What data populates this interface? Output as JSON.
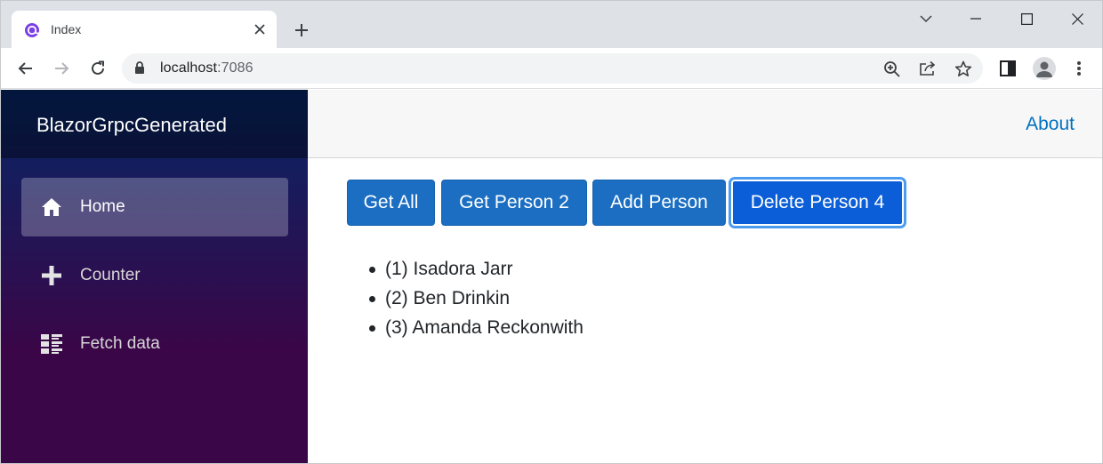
{
  "browser": {
    "tab_title": "Index",
    "url_host": "localhost",
    "url_port": ":7086"
  },
  "app": {
    "brand": "BlazorGrpcGenerated",
    "about_link": "About",
    "nav": [
      {
        "label": "Home",
        "icon": "home-icon",
        "active": true
      },
      {
        "label": "Counter",
        "icon": "plus-icon",
        "active": false
      },
      {
        "label": "Fetch data",
        "icon": "list-icon",
        "active": false
      }
    ],
    "buttons": [
      {
        "label": "Get All"
      },
      {
        "label": "Get Person 2"
      },
      {
        "label": "Add Person"
      },
      {
        "label": "Delete Person 4",
        "focused": true
      }
    ],
    "people": [
      "(1) Isadora Jarr",
      "(2) Ben Drinkin",
      "(3) Amanda Reckonwith"
    ]
  },
  "colors": {
    "accent": "#1b6ec2",
    "link": "#0071c1",
    "sidebar_top": "#052767",
    "sidebar_bottom": "#3a0647"
  }
}
